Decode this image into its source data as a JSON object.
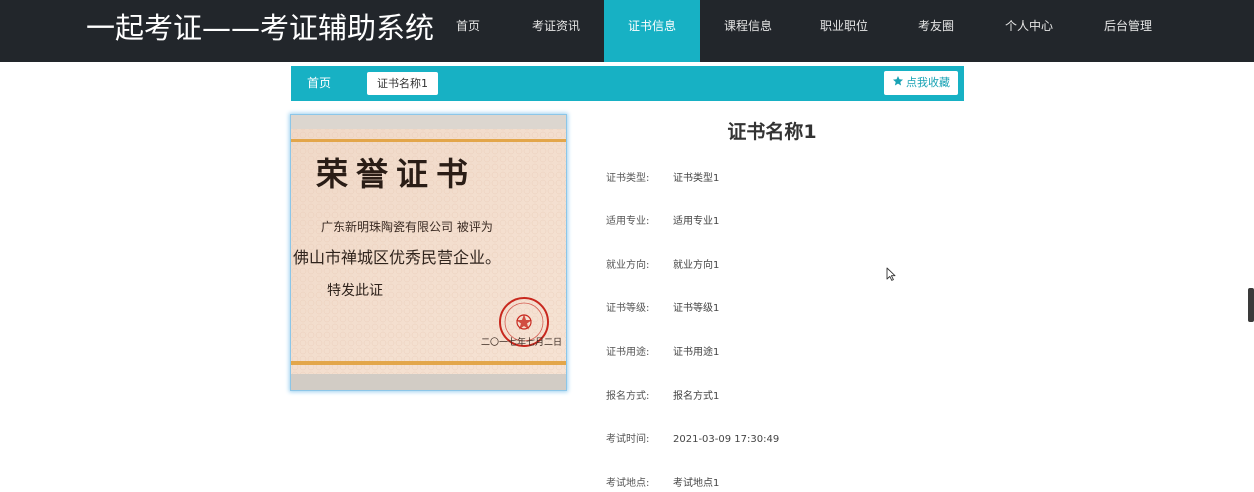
{
  "header": {
    "site_title": "一起考证——考证辅助系统",
    "nav": [
      {
        "label": "首页",
        "active": false
      },
      {
        "label": "考证资讯",
        "active": false
      },
      {
        "label": "证书信息",
        "active": true
      },
      {
        "label": "课程信息",
        "active": false
      },
      {
        "label": "职业职位",
        "active": false
      },
      {
        "label": "考友圈",
        "active": false
      },
      {
        "label": "个人中心",
        "active": false
      },
      {
        "label": "后台管理",
        "active": false
      }
    ]
  },
  "breadcrumb": {
    "home": "首页",
    "current": "证书名称1",
    "favorite_label": "点我收藏",
    "favorite_icon": "star-icon"
  },
  "certificate_image": {
    "heading": "荣誉证书",
    "line1": "广东新明珠陶瓷有限公司  被评为",
    "line2": "佛山市禅城区优秀民营企业。",
    "line3": "特发此证",
    "date_fragment": "二〇一七年七月二日"
  },
  "detail": {
    "title": "证书名称1",
    "fields": [
      {
        "label": "证书类型:",
        "value": "证书类型1"
      },
      {
        "label": "适用专业:",
        "value": "适用专业1"
      },
      {
        "label": "就业方向:",
        "value": "就业方向1"
      },
      {
        "label": "证书等级:",
        "value": "证书等级1"
      },
      {
        "label": "证书用途:",
        "value": "证书用途1"
      },
      {
        "label": "报名方式:",
        "value": "报名方式1"
      },
      {
        "label": "考试时间:",
        "value": "2021-03-09 17:30:49"
      },
      {
        "label": "考试地点:",
        "value": "考试地点1"
      }
    ]
  },
  "colors": {
    "nav_background": "#22262b",
    "accent": "#17b1c4",
    "seal_red": "#c8281e"
  }
}
